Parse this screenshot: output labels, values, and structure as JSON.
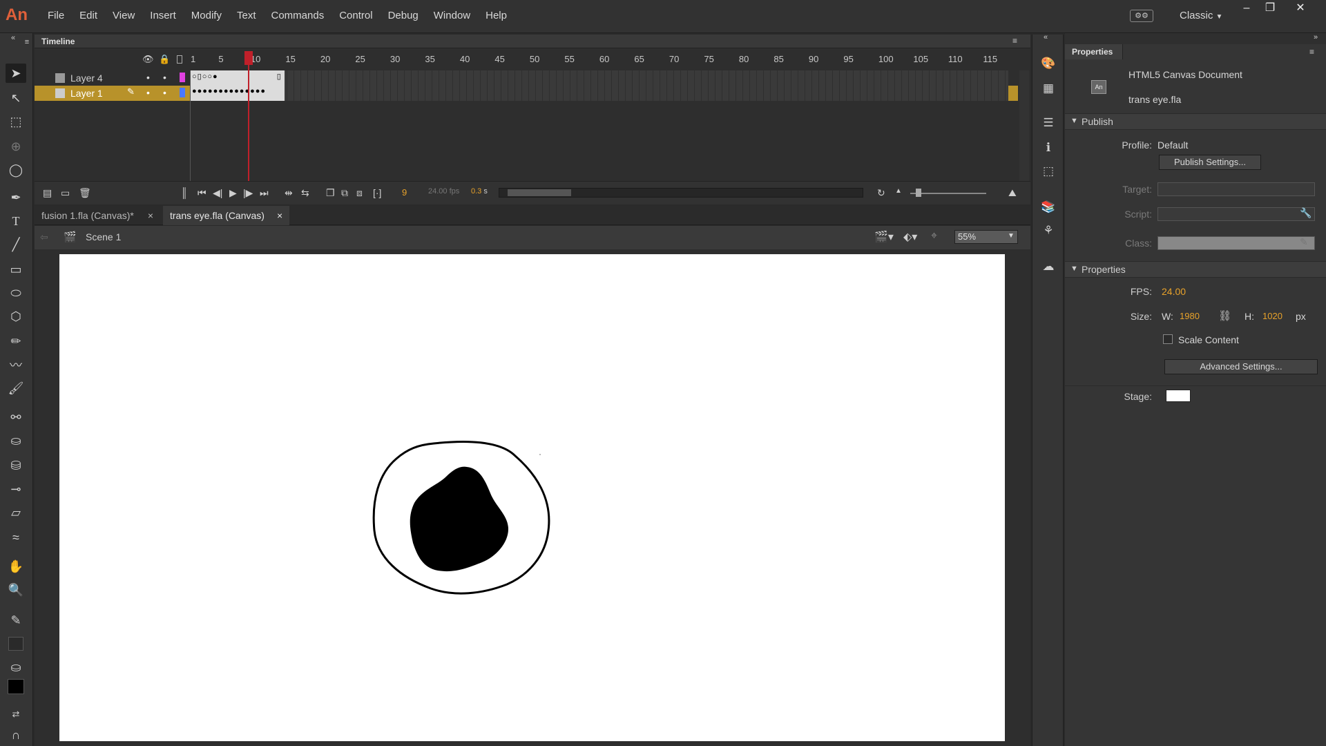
{
  "app": {
    "logo": "An",
    "menus": [
      "File",
      "Edit",
      "View",
      "Insert",
      "Modify",
      "Text",
      "Commands",
      "Control",
      "Debug",
      "Window",
      "Help"
    ],
    "workspace": "Classic",
    "window_controls": [
      "–",
      "❐",
      "✕"
    ]
  },
  "timeline": {
    "title": "Timeline",
    "frame_numbers": [
      "1",
      "5",
      "10",
      "15",
      "20",
      "25",
      "30",
      "35",
      "40",
      "45",
      "50",
      "55",
      "60",
      "65",
      "70",
      "75",
      "80",
      "85",
      "90",
      "95",
      "100",
      "105",
      "110",
      "115"
    ],
    "layers": [
      {
        "name": "Layer 4",
        "color": "#e040e0",
        "selected": false
      },
      {
        "name": "Layer 1",
        "color": "#4a78ff",
        "selected": true
      }
    ],
    "current_frame": "9",
    "fps": "24.00",
    "fps_unit": "fps",
    "elapsed": "0.3",
    "elapsed_unit": "s"
  },
  "document_tabs": [
    {
      "label": "fusion 1.fla (Canvas)*",
      "active": false
    },
    {
      "label": "trans eye.fla (Canvas)",
      "active": true
    }
  ],
  "scene": {
    "name": "Scene 1",
    "zoom": "55%"
  },
  "properties": {
    "panel_title": "Properties",
    "doc_type": "HTML5 Canvas Document",
    "doc_type_icon": "An",
    "file_name": "trans eye.fla",
    "publish": {
      "header": "Publish",
      "profile_label": "Profile:",
      "profile_value": "Default",
      "settings_button": "Publish Settings...",
      "target_label": "Target:",
      "script_label": "Script:",
      "class_label": "Class:"
    },
    "props_section": {
      "header": "Properties",
      "fps_label": "FPS:",
      "fps_value": "24.00",
      "size_label": "Size:",
      "w_label": "W:",
      "w_value": "1980",
      "h_label": "H:",
      "h_value": "1020",
      "unit": "px",
      "scale_content": "Scale Content",
      "advanced_button": "Advanced Settings...",
      "stage_label": "Stage:",
      "stage_color": "#ffffff"
    }
  },
  "colors": {
    "accent_orange": "#e8a22a",
    "playhead": "#c0202a",
    "selected_layer": "#b8922a"
  }
}
